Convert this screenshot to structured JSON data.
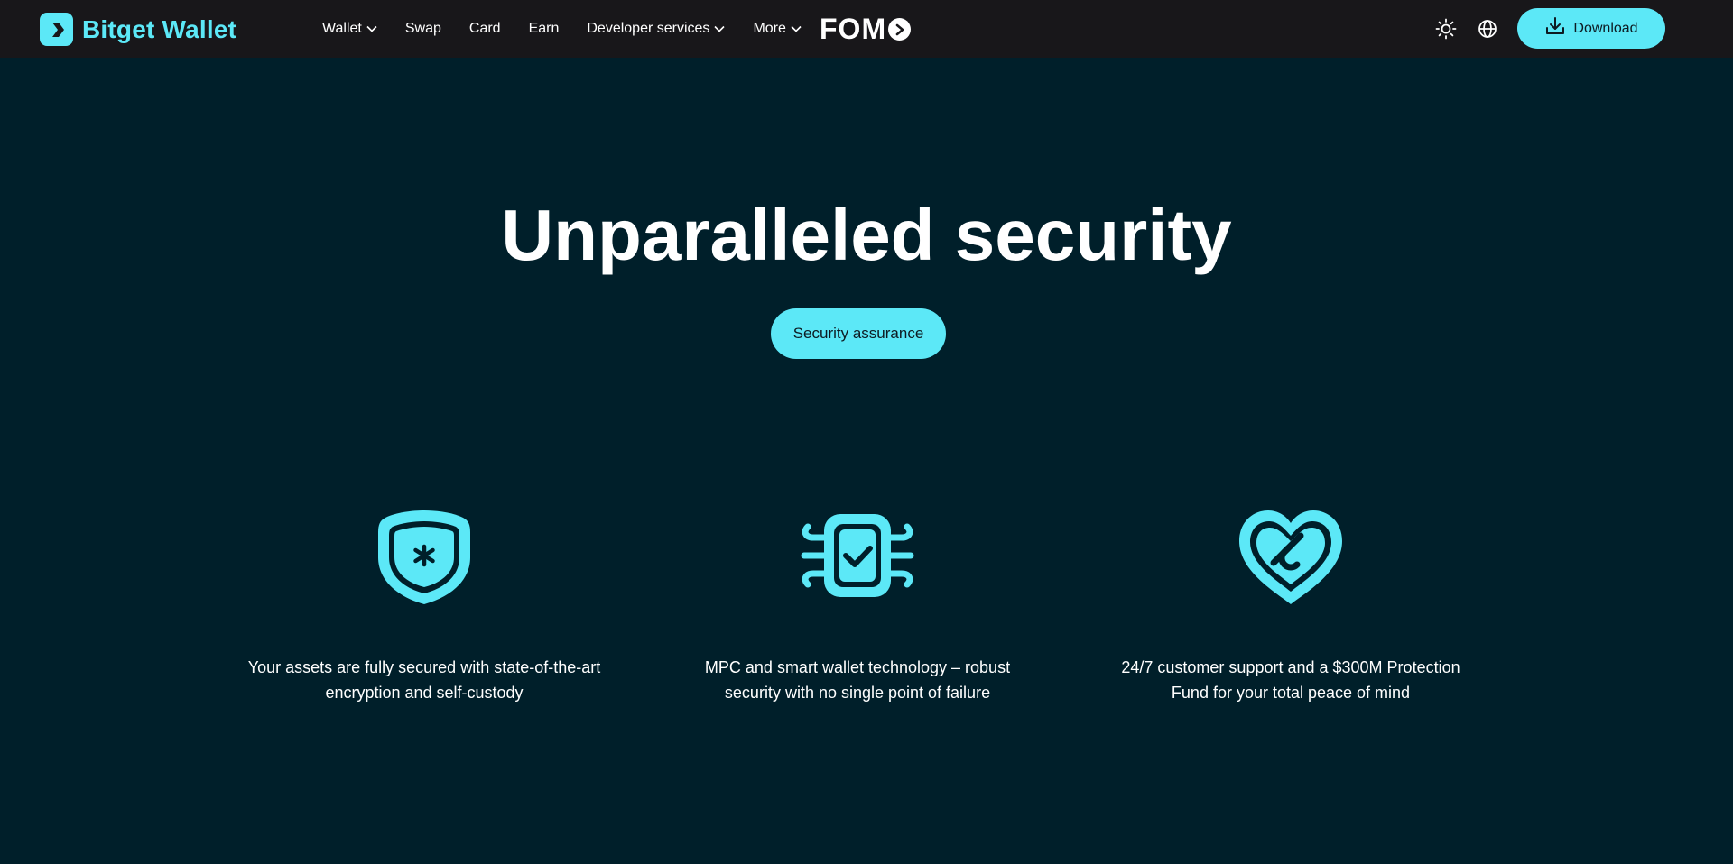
{
  "navbar": {
    "brand": "Bitget Wallet",
    "links": [
      {
        "label": "Wallet",
        "dropdown": true
      },
      {
        "label": "Swap",
        "dropdown": false
      },
      {
        "label": "Card",
        "dropdown": false
      },
      {
        "label": "Earn",
        "dropdown": false
      },
      {
        "label": "Developer services",
        "dropdown": true
      },
      {
        "label": "More",
        "dropdown": true
      }
    ],
    "fomo_logo": "FOM",
    "download_label": "Download",
    "icons": [
      "theme-sun-icon",
      "globe-icon",
      "download-icon"
    ]
  },
  "hero": {
    "title": "Unparalleled security",
    "button_label": "Security assurance"
  },
  "features": [
    {
      "icon": "shield-asterisk-icon",
      "text": "Your assets are fully secured with state-of-the-art encryption and self-custody"
    },
    {
      "icon": "chip-check-icon",
      "text": "MPC and smart wallet technology – robust security with no single point of failure"
    },
    {
      "icon": "heart-handshake-icon",
      "text": "24/7 customer support and a $300M Protection Fund for your total peace of mind"
    }
  ],
  "colors": {
    "accent": "#5ce8f7",
    "background": "#001f2a",
    "navbar": "#18171a"
  }
}
